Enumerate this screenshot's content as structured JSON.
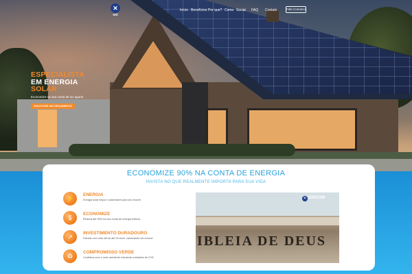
{
  "nav": {
    "logo_text": "oxi",
    "items": [
      "Início",
      "Benefícios",
      "Por que?",
      "Como",
      "Social",
      "FAQ",
      "Contato"
    ],
    "cta_label": "Fale Conosco"
  },
  "hero": {
    "title_line1": "ESPECIALISTA",
    "title_line2": "EM ENERGIA",
    "title_line3": "SOLAR",
    "subtitle": "Economize na sua conta de luz agora!",
    "cta_label": "SOLICITAR UM ORÇAMENTO"
  },
  "section": {
    "title": "ECONOMIZE 90% NA CONTA DE ENERGIA",
    "subtitle": "INVISTA NO QUE REALMENTE IMPORTA PARA SUA VIDA"
  },
  "features": [
    {
      "icon": "lightning-icon",
      "title": "ENERGIA",
      "desc": "Energia solar limpa e sustentável para seu imóvel"
    },
    {
      "icon": "savings-icon",
      "title": "ECONOMIZE",
      "desc": "Reduza até 90% na sua conta de energia elétrica"
    },
    {
      "icon": "investment-icon",
      "title": "INVESTIMENTO DURADOURO",
      "desc": "Painéis com vida útil de até 25 anos, valorizando seu imóvel"
    },
    {
      "icon": "leaf-icon",
      "title": "COMPROMISSO VERDE",
      "desc": "Contribua com o meio ambiente reduzindo emissões de CO2"
    }
  ],
  "photo": {
    "watermark": "OXICOM",
    "sign_text": "IBLEIA DE DEUS"
  }
}
